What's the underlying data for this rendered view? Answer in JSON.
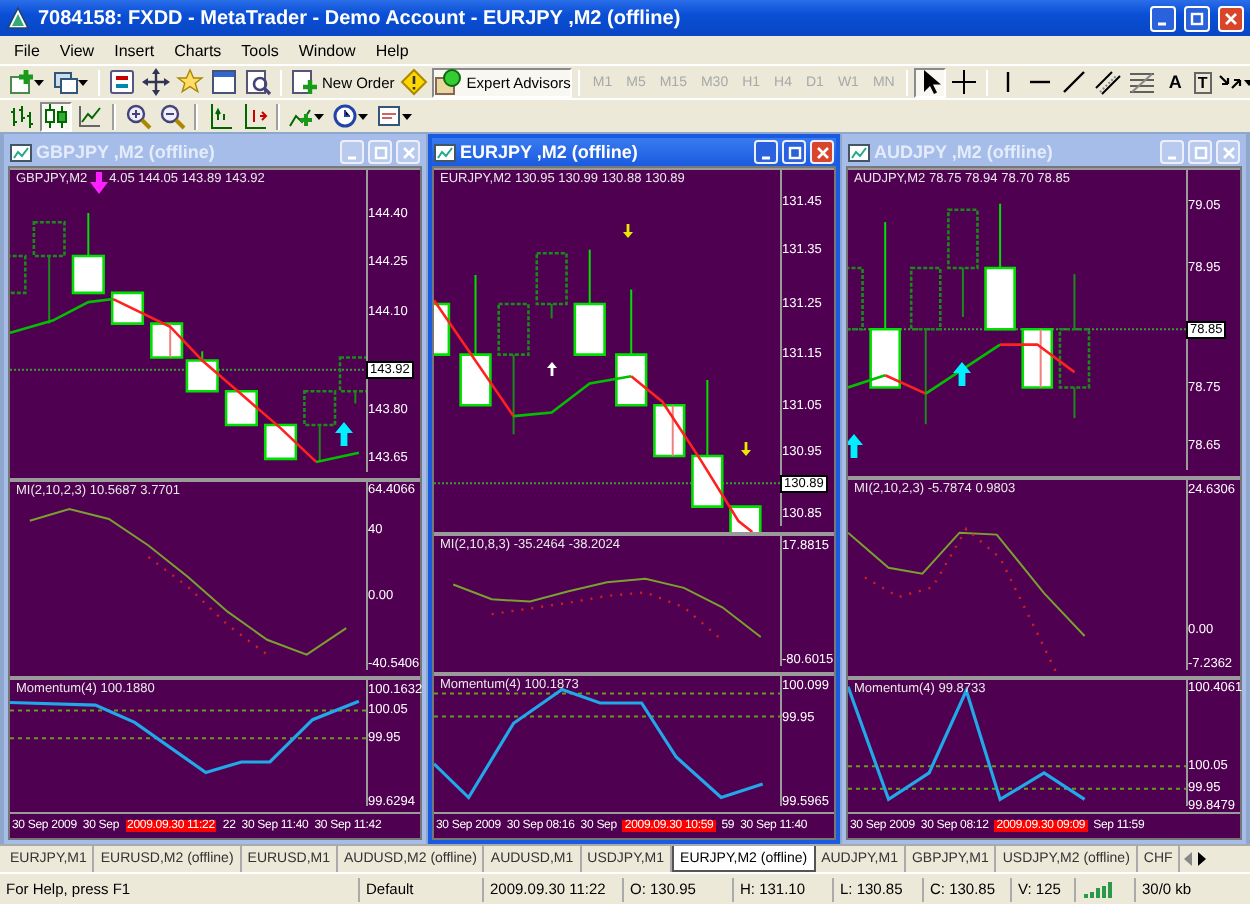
{
  "window": {
    "title": "7084158: FXDD - MetaTrader - Demo Account - EURJPY ,M2 (offline)"
  },
  "menu": [
    "File",
    "View",
    "Insert",
    "Charts",
    "Tools",
    "Window",
    "Help"
  ],
  "toolbar": {
    "new_order": "New Order",
    "expert_advisors": {
      "label": "Expert Advisors",
      "on": true
    },
    "timeframes": [
      {
        "label": "M1",
        "disabled": true
      },
      {
        "label": "M5",
        "disabled": true
      },
      {
        "label": "M15",
        "disabled": true
      },
      {
        "label": "M30",
        "disabled": true
      },
      {
        "label": "H1",
        "disabled": true
      },
      {
        "label": "H4",
        "disabled": true
      },
      {
        "label": "D1",
        "disabled": true
      },
      {
        "label": "W1",
        "disabled": true
      },
      {
        "label": "MN",
        "disabled": true
      }
    ],
    "text_tool": "A",
    "label_tool": "T",
    "chart_types": [
      {
        "kind": "bars",
        "selected": false
      },
      {
        "kind": "candles",
        "selected": true
      },
      {
        "kind": "line",
        "selected": false
      }
    ]
  },
  "charts": [
    {
      "title": "GBPJPY ,M2 (offline)",
      "active": false,
      "main": {
        "label_parts": [
          "GBPJPY,M2",
          "4.05 144.05 143.89 143.92"
        ],
        "axis": [
          {
            "text": "144.40",
            "kind": "tick"
          },
          {
            "text": "144.25",
            "kind": "tick"
          },
          {
            "text": "144.10",
            "kind": "tick"
          },
          {
            "text": "143.92",
            "kind": "current"
          },
          {
            "text": "143.80",
            "kind": "tick"
          },
          {
            "text": "143.65",
            "kind": "tick"
          }
        ]
      },
      "indicators": [
        {
          "label": "MI(2,10,2,3) 10.5687 3.7701",
          "chart_data": {
            "type": "line",
            "categories": [
              null,
              null,
              null,
              null,
              null,
              null,
              null,
              null,
              null
            ],
            "ylim": [
              -48.2,
              69.4
            ],
            "yticks": [
              {
                "value": 64.4066,
                "label": "64.4066"
              },
              {
                "value": 40,
                "label": "40"
              },
              {
                "value": 0,
                "label": "0.00"
              },
              {
                "value": -40.5406,
                "label": "-40.5406"
              }
            ],
            "series": [
              {
                "color": "#7aa030",
                "line_style": "solid",
                "values": [
                  46,
                  53,
                  47,
                  31,
                  12,
                  -9,
                  -26,
                  -35,
                  -19
                ]
              },
              {
                "color": "#d02020",
                "line_style": "dotted",
                "values": [
                  null,
                  null,
                  null,
                  24,
                  6,
                  -17,
                  -35,
                  null,
                  null
                ]
              }
            ]
          }
        },
        {
          "label": "Momentum(4) 100.1880",
          "axis": [
            {
              "text": "100.1632",
              "kind": "tick"
            },
            {
              "text": "100.05",
              "kind": "tick"
            },
            {
              "text": "99.95",
              "kind": "tick"
            },
            {
              "text": "99.6294",
              "kind": "tick"
            }
          ]
        }
      ],
      "time_axis": [
        {
          "text": "30 Sep 2009",
          "kind": "tick"
        },
        {
          "text": "30 Sep",
          "kind": "tick"
        },
        {
          "text": "2009.09.30 11:22",
          "kind": "cursor"
        },
        {
          "text": "22",
          "kind": "tick"
        },
        {
          "text": "30 Sep 11:40",
          "kind": "tick"
        },
        {
          "text": "30 Sep 11:42",
          "kind": "tick"
        }
      ]
    },
    {
      "title": "EURJPY ,M2 (offline)",
      "active": true,
      "main": {
        "label_parts": [
          "EURJPY,M2 130.95 130.99 130.88 130.89"
        ],
        "axis": [
          {
            "text": "131.45",
            "kind": "tick"
          },
          {
            "text": "131.35",
            "kind": "tick"
          },
          {
            "text": "131.25",
            "kind": "tick"
          },
          {
            "text": "131.15",
            "kind": "tick"
          },
          {
            "text": "131.05",
            "kind": "tick"
          },
          {
            "text": "130.95",
            "kind": "tick"
          },
          {
            "text": "130.89",
            "kind": "current"
          },
          {
            "text": "130.85",
            "kind": "tick"
          }
        ]
      },
      "indicators": [
        {
          "label": "MI(2,10,8,3) -35.2464 -38.2024",
          "chart_data": {
            "type": "line",
            "categories": [
              null,
              null,
              null,
              null,
              null,
              null,
              null,
              null,
              null
            ],
            "ylim": [
              -92.6,
              27.5
            ],
            "yticks": [
              {
                "value": 17.8815,
                "label": "17.8815"
              },
              {
                "value": -80.6015,
                "label": "-80.6015"
              }
            ],
            "series": [
              {
                "color": "#7aa030",
                "line_style": "solid",
                "values": [
                  -15,
                  -28,
                  -30,
                  -21,
                  -13,
                  -10,
                  -18,
                  -35,
                  -61
                ]
              },
              {
                "color": "#d02020",
                "line_style": "dotted",
                "values": [
                  null,
                  -41,
                  -36,
                  -31,
                  -25,
                  -22,
                  -35,
                  -64,
                  null
                ]
              }
            ]
          }
        },
        {
          "label": "Momentum(4) 100.1873",
          "axis": [
            {
              "text": "100.099",
              "kind": "tick"
            },
            {
              "text": "99.95",
              "kind": "tick"
            },
            {
              "text": "99.5965",
              "kind": "tick"
            }
          ]
        }
      ],
      "time_axis": [
        {
          "text": "30 Sep 2009",
          "kind": "tick"
        },
        {
          "text": "30 Sep 08:16",
          "kind": "tick"
        },
        {
          "text": "30 Sep",
          "kind": "tick"
        },
        {
          "text": "2009.09.30 10:59",
          "kind": "cursor"
        },
        {
          "text": "59",
          "kind": "tick"
        },
        {
          "text": "30 Sep 11:40",
          "kind": "tick"
        }
      ]
    },
    {
      "title": "AUDJPY ,M2 (offline)",
      "active": false,
      "main": {
        "label_parts": [
          "AUDJPY,M2 78.75 78.94 78.70 78.85"
        ],
        "axis": [
          {
            "text": "79.05",
            "kind": "tick"
          },
          {
            "text": "78.95",
            "kind": "tick"
          },
          {
            "text": "78.85",
            "kind": "current"
          },
          {
            "text": "78.75",
            "kind": "tick"
          },
          {
            "text": "78.65",
            "kind": "tick"
          }
        ]
      },
      "indicators": [
        {
          "label": "MI(2,10,2,3) -5.7874 0.9803",
          "axis": [
            {
              "text": "24.6306",
              "kind": "tick"
            },
            {
              "text": "0.00",
              "kind": "tick"
            },
            {
              "text": "-7.2362",
              "kind": "tick"
            }
          ]
        },
        {
          "label": "Momentum(4) 99.8733",
          "axis": [
            {
              "text": "100.4061",
              "kind": "tick"
            },
            {
              "text": "100.05",
              "kind": "tick"
            },
            {
              "text": "99.95",
              "kind": "tick"
            },
            {
              "text": "99.8479",
              "kind": "tick"
            }
          ]
        }
      ],
      "time_axis": [
        {
          "text": "30 Sep 2009",
          "kind": "tick"
        },
        {
          "text": "30 Sep 08:12",
          "kind": "tick"
        },
        {
          "text": "2009.09.30 09:09",
          "kind": "cursor"
        },
        {
          "text": "Sep 11:59",
          "kind": "tick"
        }
      ]
    }
  ],
  "tabs": [
    {
      "label": "EURJPY,M1",
      "selected": false
    },
    {
      "label": "EURUSD,M2 (offline)",
      "selected": false
    },
    {
      "label": "EURUSD,M1",
      "selected": false
    },
    {
      "label": "AUDUSD,M2 (offline)",
      "selected": false
    },
    {
      "label": "AUDUSD,M1",
      "selected": false
    },
    {
      "label": "USDJPY,M1",
      "selected": false
    },
    {
      "label": "EURJPY,M2 (offline)",
      "selected": true
    },
    {
      "label": "AUDJPY,M1",
      "selected": false
    },
    {
      "label": "GBPJPY,M1",
      "selected": false
    },
    {
      "label": "USDJPY,M2 (offline)",
      "selected": false
    },
    {
      "label": "CHF",
      "selected": false
    }
  ],
  "status_bar": {
    "help": "For Help, press F1",
    "profile": "Default",
    "time": "2009.09.30 11:22",
    "open": "O: 130.95",
    "high": "H: 131.10",
    "low": "L: 130.85",
    "close": "C: 130.85",
    "volume": "V: 125",
    "traffic": "30/0 kb"
  }
}
